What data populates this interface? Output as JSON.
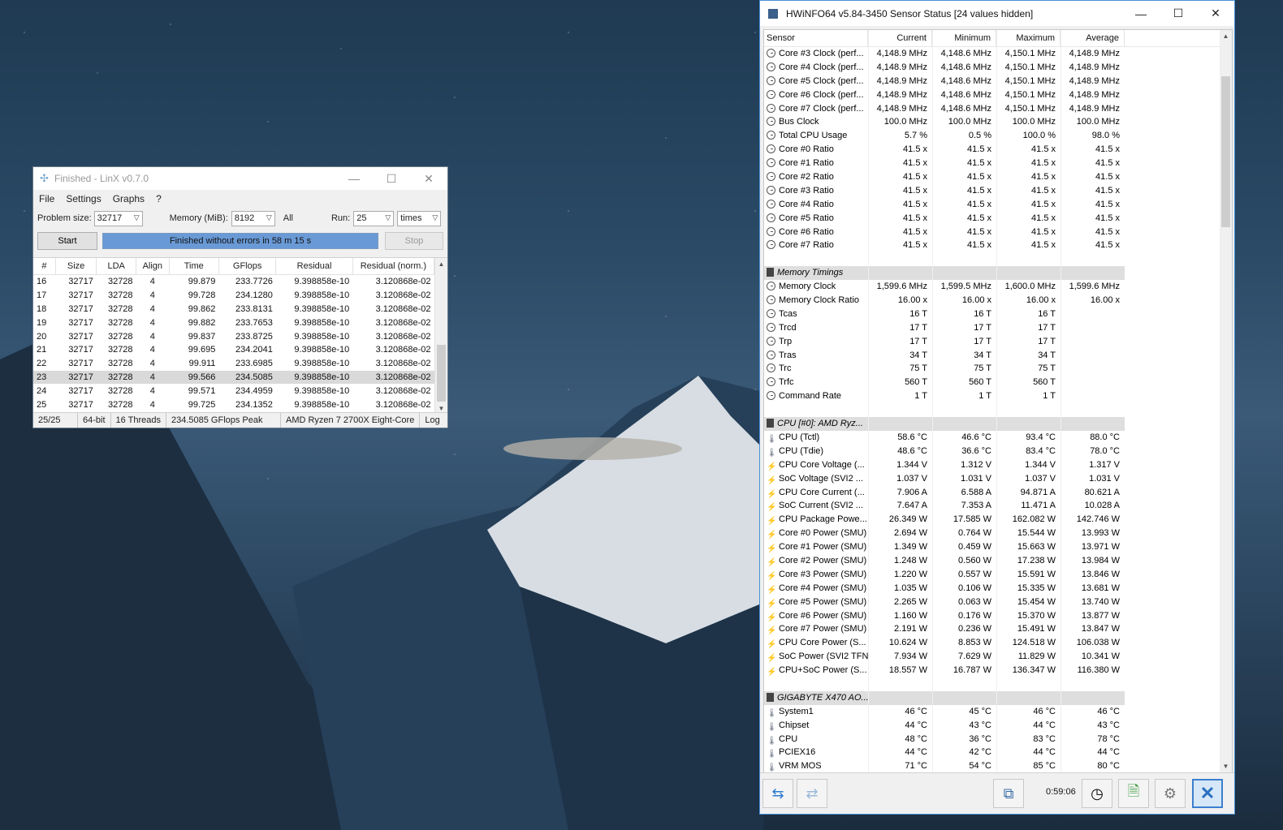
{
  "linx": {
    "title": "Finished - LinX v0.7.0",
    "menu": [
      "File",
      "Settings",
      "Graphs",
      "?"
    ],
    "problem_size_label": "Problem size:",
    "problem_size_value": "32717",
    "memory_label": "Memory (MiB):",
    "memory_value": "8192",
    "all_label": "All",
    "run_label": "Run:",
    "run_value": "25",
    "times_value": "times",
    "start_label": "Start",
    "progress_text": "Finished without errors in 58 m 15 s",
    "stop_label": "Stop",
    "columns": [
      "#",
      "Size",
      "LDA",
      "Align",
      "Time",
      "GFlops",
      "Residual",
      "Residual (norm.)"
    ],
    "rows": [
      [
        "16",
        "32717",
        "32728",
        "4",
        "99.879",
        "233.7726",
        "9.398858e-10",
        "3.120868e-02"
      ],
      [
        "17",
        "32717",
        "32728",
        "4",
        "99.728",
        "234.1280",
        "9.398858e-10",
        "3.120868e-02"
      ],
      [
        "18",
        "32717",
        "32728",
        "4",
        "99.862",
        "233.8131",
        "9.398858e-10",
        "3.120868e-02"
      ],
      [
        "19",
        "32717",
        "32728",
        "4",
        "99.882",
        "233.7653",
        "9.398858e-10",
        "3.120868e-02"
      ],
      [
        "20",
        "32717",
        "32728",
        "4",
        "99.837",
        "233.8725",
        "9.398858e-10",
        "3.120868e-02"
      ],
      [
        "21",
        "32717",
        "32728",
        "4",
        "99.695",
        "234.2041",
        "9.398858e-10",
        "3.120868e-02"
      ],
      [
        "22",
        "32717",
        "32728",
        "4",
        "99.911",
        "233.6985",
        "9.398858e-10",
        "3.120868e-02"
      ],
      [
        "23",
        "32717",
        "32728",
        "4",
        "99.566",
        "234.5085",
        "9.398858e-10",
        "3.120868e-02"
      ],
      [
        "24",
        "32717",
        "32728",
        "4",
        "99.571",
        "234.4959",
        "9.398858e-10",
        "3.120868e-02"
      ],
      [
        "25",
        "32717",
        "32728",
        "4",
        "99.725",
        "234.1352",
        "9.398858e-10",
        "3.120868e-02"
      ]
    ],
    "selected_row": "23",
    "status": [
      "25/25",
      "64-bit",
      "16 Threads",
      "234.5085 GFlops Peak",
      "AMD Ryzen 7 2700X Eight-Core",
      "Log"
    ]
  },
  "hwinfo": {
    "title": "HWiNFO64 v5.84-3450 Sensor Status [24 values hidden]",
    "columns": [
      "Sensor",
      "Current",
      "Minimum",
      "Maximum",
      "Average"
    ],
    "rows": [
      {
        "icon": "clock",
        "name": "Core #3 Clock (perf...",
        "v": [
          "4,148.9 MHz",
          "4,148.6 MHz",
          "4,150.1 MHz",
          "4,148.9 MHz"
        ]
      },
      {
        "icon": "clock",
        "name": "Core #4 Clock (perf...",
        "v": [
          "4,148.9 MHz",
          "4,148.6 MHz",
          "4,150.1 MHz",
          "4,148.9 MHz"
        ]
      },
      {
        "icon": "clock",
        "name": "Core #5 Clock (perf...",
        "v": [
          "4,148.9 MHz",
          "4,148.6 MHz",
          "4,150.1 MHz",
          "4,148.9 MHz"
        ]
      },
      {
        "icon": "clock",
        "name": "Core #6 Clock (perf...",
        "v": [
          "4,148.9 MHz",
          "4,148.6 MHz",
          "4,150.1 MHz",
          "4,148.9 MHz"
        ]
      },
      {
        "icon": "clock",
        "name": "Core #7 Clock (perf...",
        "v": [
          "4,148.9 MHz",
          "4,148.6 MHz",
          "4,150.1 MHz",
          "4,148.9 MHz"
        ]
      },
      {
        "icon": "clock",
        "name": "Bus Clock",
        "v": [
          "100.0 MHz",
          "100.0 MHz",
          "100.0 MHz",
          "100.0 MHz"
        ]
      },
      {
        "icon": "clock",
        "name": "Total CPU Usage",
        "v": [
          "5.7 %",
          "0.5 %",
          "100.0 %",
          "98.0 %"
        ]
      },
      {
        "icon": "clock",
        "name": "Core #0 Ratio",
        "v": [
          "41.5 x",
          "41.5 x",
          "41.5 x",
          "41.5 x"
        ]
      },
      {
        "icon": "clock",
        "name": "Core #1 Ratio",
        "v": [
          "41.5 x",
          "41.5 x",
          "41.5 x",
          "41.5 x"
        ]
      },
      {
        "icon": "clock",
        "name": "Core #2 Ratio",
        "v": [
          "41.5 x",
          "41.5 x",
          "41.5 x",
          "41.5 x"
        ]
      },
      {
        "icon": "clock",
        "name": "Core #3 Ratio",
        "v": [
          "41.5 x",
          "41.5 x",
          "41.5 x",
          "41.5 x"
        ]
      },
      {
        "icon": "clock",
        "name": "Core #4 Ratio",
        "v": [
          "41.5 x",
          "41.5 x",
          "41.5 x",
          "41.5 x"
        ]
      },
      {
        "icon": "clock",
        "name": "Core #5 Ratio",
        "v": [
          "41.5 x",
          "41.5 x",
          "41.5 x",
          "41.5 x"
        ]
      },
      {
        "icon": "clock",
        "name": "Core #6 Ratio",
        "v": [
          "41.5 x",
          "41.5 x",
          "41.5 x",
          "41.5 x"
        ]
      },
      {
        "icon": "clock",
        "name": "Core #7 Ratio",
        "v": [
          "41.5 x",
          "41.5 x",
          "41.5 x",
          "41.5 x"
        ]
      },
      {
        "icon": "blank",
        "name": "",
        "v": [
          "",
          "",
          "",
          ""
        ]
      },
      {
        "icon": "group",
        "name": "Memory Timings",
        "v": [
          "",
          "",
          "",
          ""
        ]
      },
      {
        "icon": "clock",
        "name": "Memory Clock",
        "v": [
          "1,599.6 MHz",
          "1,599.5 MHz",
          "1,600.0 MHz",
          "1,599.6 MHz"
        ]
      },
      {
        "icon": "clock",
        "name": "Memory Clock Ratio",
        "v": [
          "16.00 x",
          "16.00 x",
          "16.00 x",
          "16.00 x"
        ]
      },
      {
        "icon": "clock",
        "name": "Tcas",
        "v": [
          "16 T",
          "16 T",
          "16 T",
          ""
        ]
      },
      {
        "icon": "clock",
        "name": "Trcd",
        "v": [
          "17 T",
          "17 T",
          "17 T",
          ""
        ]
      },
      {
        "icon": "clock",
        "name": "Trp",
        "v": [
          "17 T",
          "17 T",
          "17 T",
          ""
        ]
      },
      {
        "icon": "clock",
        "name": "Tras",
        "v": [
          "34 T",
          "34 T",
          "34 T",
          ""
        ]
      },
      {
        "icon": "clock",
        "name": "Trc",
        "v": [
          "75 T",
          "75 T",
          "75 T",
          ""
        ]
      },
      {
        "icon": "clock",
        "name": "Trfc",
        "v": [
          "560 T",
          "560 T",
          "560 T",
          ""
        ]
      },
      {
        "icon": "clock",
        "name": "Command Rate",
        "v": [
          "1 T",
          "1 T",
          "1 T",
          ""
        ]
      },
      {
        "icon": "blank",
        "name": "",
        "v": [
          "",
          "",
          "",
          ""
        ]
      },
      {
        "icon": "group",
        "name": "CPU [#0]: AMD Ryz...",
        "v": [
          "",
          "",
          "",
          ""
        ]
      },
      {
        "icon": "temp",
        "name": "CPU (Tctl)",
        "v": [
          "58.6 °C",
          "46.6 °C",
          "93.4 °C",
          "88.0 °C"
        ]
      },
      {
        "icon": "temp",
        "name": "CPU (Tdie)",
        "v": [
          "48.6 °C",
          "36.6 °C",
          "83.4 °C",
          "78.0 °C"
        ]
      },
      {
        "icon": "volt",
        "name": "CPU Core Voltage (...",
        "v": [
          "1.344 V",
          "1.312 V",
          "1.344 V",
          "1.317 V"
        ]
      },
      {
        "icon": "volt",
        "name": "SoC Voltage (SVI2 ...",
        "v": [
          "1.037 V",
          "1.031 V",
          "1.037 V",
          "1.031 V"
        ]
      },
      {
        "icon": "volt",
        "name": "CPU Core Current (...",
        "v": [
          "7.906 A",
          "6.588 A",
          "94.871 A",
          "80.621 A"
        ]
      },
      {
        "icon": "volt",
        "name": "SoC Current (SVI2 ...",
        "v": [
          "7.647 A",
          "7.353 A",
          "11.471 A",
          "10.028 A"
        ]
      },
      {
        "icon": "volt",
        "name": "CPU Package Powe...",
        "v": [
          "26.349 W",
          "17.585 W",
          "162.082 W",
          "142.746 W"
        ]
      },
      {
        "icon": "volt",
        "name": "Core #0 Power (SMU)",
        "v": [
          "2.694 W",
          "0.764 W",
          "15.544 W",
          "13.993 W"
        ]
      },
      {
        "icon": "volt",
        "name": "Core #1 Power (SMU)",
        "v": [
          "1.349 W",
          "0.459 W",
          "15.663 W",
          "13.971 W"
        ]
      },
      {
        "icon": "volt",
        "name": "Core #2 Power (SMU)",
        "v": [
          "1.248 W",
          "0.560 W",
          "17.238 W",
          "13.984 W"
        ]
      },
      {
        "icon": "volt",
        "name": "Core #3 Power (SMU)",
        "v": [
          "1.220 W",
          "0.557 W",
          "15.591 W",
          "13.846 W"
        ]
      },
      {
        "icon": "volt",
        "name": "Core #4 Power (SMU)",
        "v": [
          "1.035 W",
          "0.106 W",
          "15.335 W",
          "13.681 W"
        ]
      },
      {
        "icon": "volt",
        "name": "Core #5 Power (SMU)",
        "v": [
          "2.265 W",
          "0.063 W",
          "15.454 W",
          "13.740 W"
        ]
      },
      {
        "icon": "volt",
        "name": "Core #6 Power (SMU)",
        "v": [
          "1.160 W",
          "0.176 W",
          "15.370 W",
          "13.877 W"
        ]
      },
      {
        "icon": "volt",
        "name": "Core #7 Power (SMU)",
        "v": [
          "2.191 W",
          "0.236 W",
          "15.491 W",
          "13.847 W"
        ]
      },
      {
        "icon": "volt",
        "name": "CPU Core Power (S...",
        "v": [
          "10.624 W",
          "8.853 W",
          "124.518 W",
          "106.038 W"
        ]
      },
      {
        "icon": "volt",
        "name": "SoC Power (SVI2 TFN)",
        "v": [
          "7.934 W",
          "7.629 W",
          "11.829 W",
          "10.341 W"
        ]
      },
      {
        "icon": "volt",
        "name": "CPU+SoC Power (S...",
        "v": [
          "18.557 W",
          "16.787 W",
          "136.347 W",
          "116.380 W"
        ]
      },
      {
        "icon": "blank",
        "name": "",
        "v": [
          "",
          "",
          "",
          ""
        ]
      },
      {
        "icon": "group",
        "name": "GIGABYTE X470 AO...",
        "v": [
          "",
          "",
          "",
          ""
        ]
      },
      {
        "icon": "temp",
        "name": "System1",
        "v": [
          "46 °C",
          "45 °C",
          "46 °C",
          "46 °C"
        ]
      },
      {
        "icon": "temp",
        "name": "Chipset",
        "v": [
          "44 °C",
          "43 °C",
          "44 °C",
          "43 °C"
        ]
      },
      {
        "icon": "temp",
        "name": "CPU",
        "v": [
          "48 °C",
          "36 °C",
          "83 °C",
          "78 °C"
        ]
      },
      {
        "icon": "temp",
        "name": "PCIEX16",
        "v": [
          "44 °C",
          "42 °C",
          "44 °C",
          "44 °C"
        ]
      },
      {
        "icon": "temp",
        "name": "VRM MOS",
        "v": [
          "71 °C",
          "54 °C",
          "85 °C",
          "80 °C"
        ]
      }
    ],
    "timer": "0:59:06"
  }
}
